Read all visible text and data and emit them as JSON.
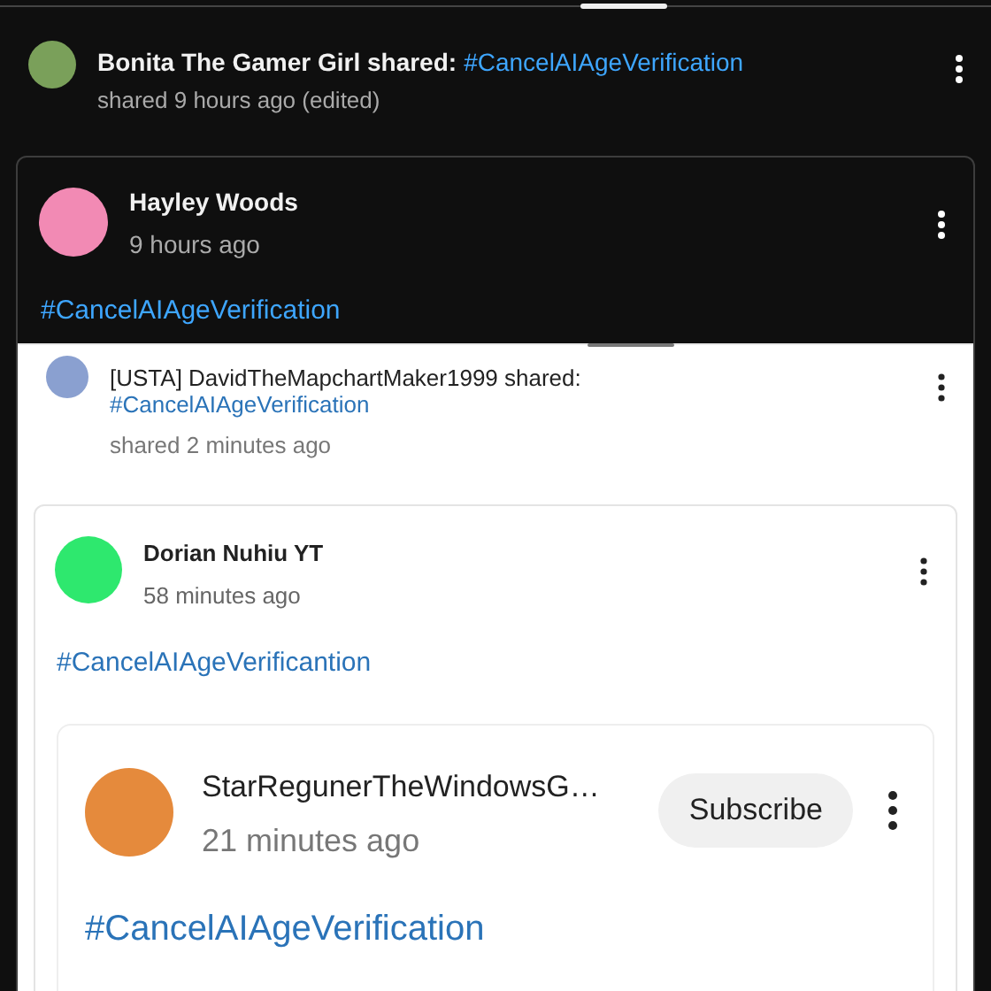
{
  "post": {
    "author": "Bonita The Gamer Girl shared:",
    "hashtag": "#CancelAIAgeVerification",
    "meta": "shared 9 hours ago (edited)",
    "shared_post": {
      "author": "Hayley Woods",
      "time": "9 hours ago",
      "hashtag": "#CancelAIAgeVerification",
      "screenshot": {
        "author": "[USTA] DavidTheMapchartMaker1999 shared:",
        "hashtag": "#CancelAIAgeVerification",
        "meta": "shared 2 minutes ago",
        "shared_post": {
          "author": "Dorian Nuhiu YT",
          "time": "58 minutes ago",
          "hashtag": "#CancelAIAgeVerificantion",
          "shared_post": {
            "author": "StarRegunerTheWindowsG…",
            "time": "21 minutes ago",
            "subscribe": "Subscribe",
            "hashtag": "#CancelAIAgeVerification"
          }
        }
      }
    }
  }
}
